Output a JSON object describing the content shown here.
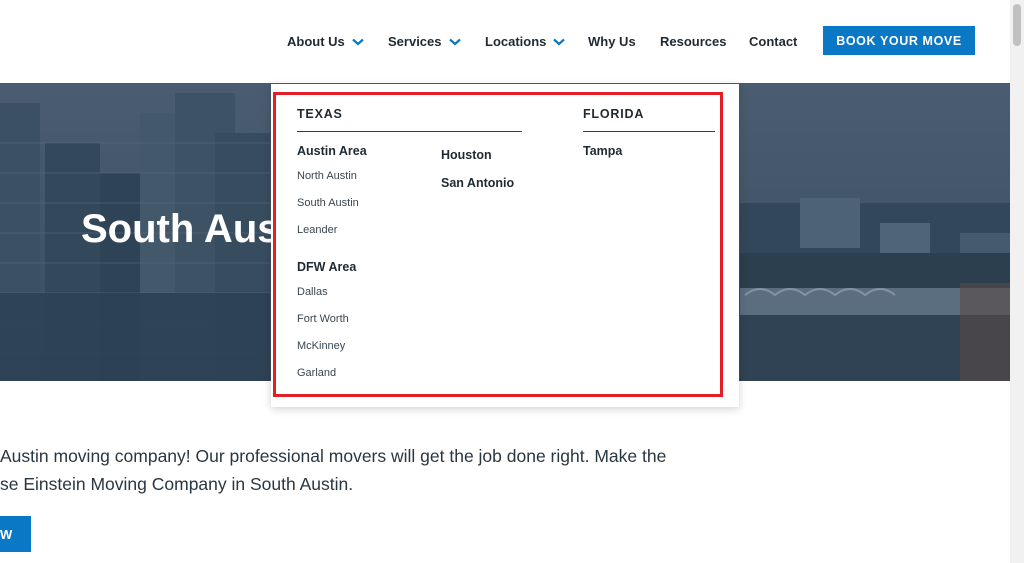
{
  "colors": {
    "accent": "#0b78c5",
    "highlight": "#e31e24",
    "text": "#1f2a33"
  },
  "nav": {
    "items": [
      {
        "label": "About Us",
        "has_dropdown": true
      },
      {
        "label": "Services",
        "has_dropdown": true
      },
      {
        "label": "Locations",
        "has_dropdown": true
      },
      {
        "label": "Why Us",
        "has_dropdown": false
      },
      {
        "label": "Resources",
        "has_dropdown": false
      },
      {
        "label": "Contact",
        "has_dropdown": false
      }
    ],
    "book_label": "BOOK YOUR MOVE"
  },
  "hero": {
    "title": "South Aus"
  },
  "intro": {
    "line1": "Austin moving company! Our professional movers will get the job done right. Make the",
    "line2": "se Einstein Moving Company in South Austin.",
    "cta_label": "W"
  },
  "locations_menu": {
    "texas": {
      "title": "TEXAS",
      "austin_area": {
        "title": "Austin Area",
        "cities": [
          "North Austin",
          "South Austin",
          "Leander"
        ]
      },
      "dfw_area": {
        "title": "DFW Area",
        "cities": [
          "Dallas",
          "Fort Worth",
          "McKinney",
          "Garland"
        ]
      },
      "other": [
        "Houston",
        "San Antonio"
      ]
    },
    "florida": {
      "title": "FLORIDA",
      "cities": [
        "Tampa"
      ]
    }
  },
  "icons": {
    "dropdown_chevron": "chevron-down-icon"
  }
}
